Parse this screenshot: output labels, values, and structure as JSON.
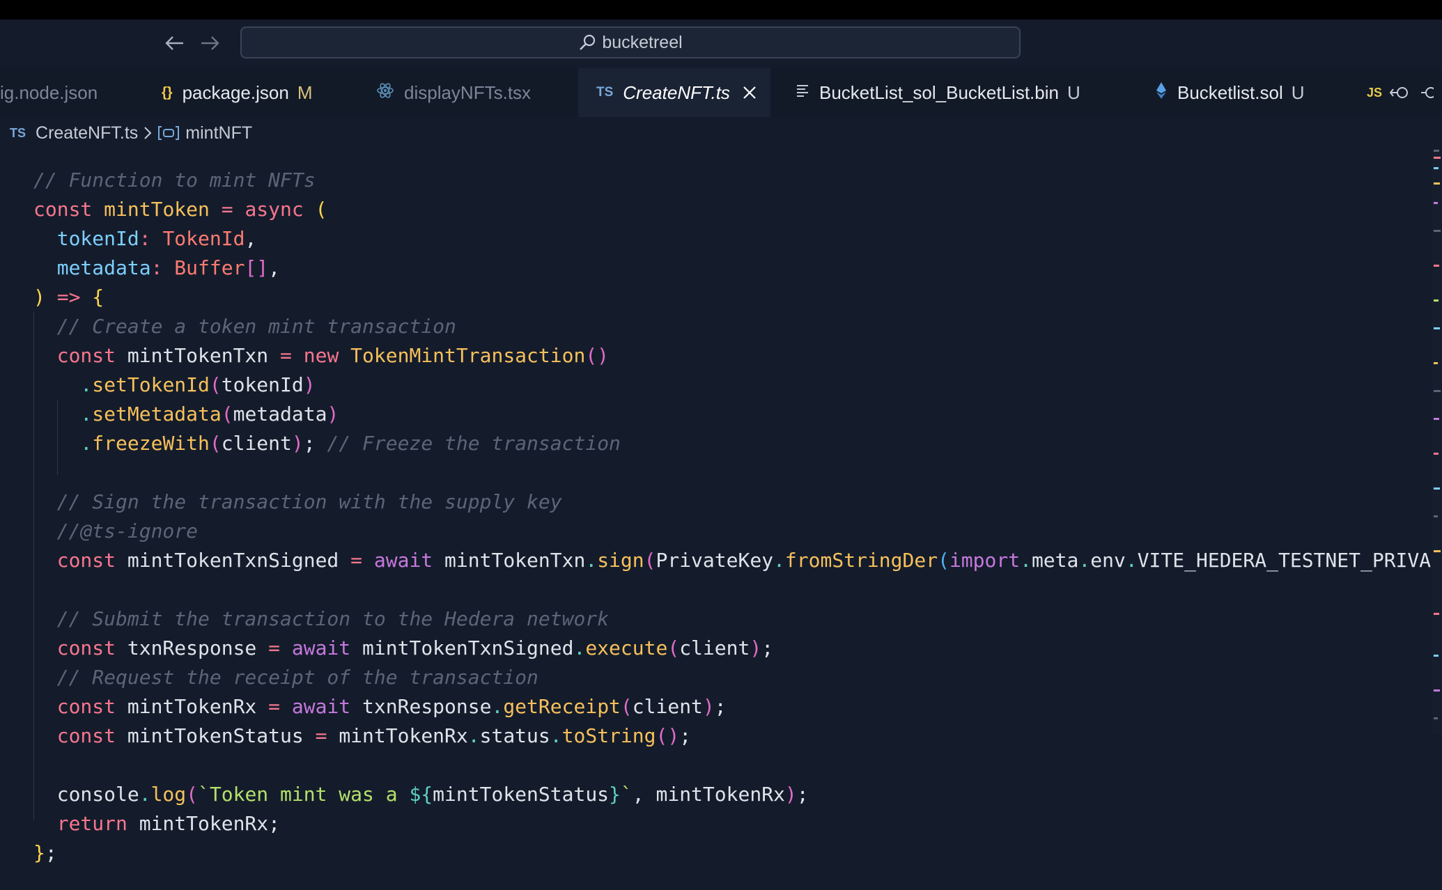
{
  "search": {
    "text": "bucketreel"
  },
  "tabs": [
    {
      "label": "ig.node.json",
      "icon": "",
      "mark": "",
      "state": "inactive"
    },
    {
      "label": "package.json",
      "icon": "{}",
      "mark": "M",
      "state": "normal"
    },
    {
      "label": "displayNFTs.tsx",
      "icon": "react-icon",
      "mark": "",
      "state": "inactive"
    },
    {
      "label": "CreateNFT.ts",
      "icon": "TS",
      "mark": "",
      "state": "active"
    },
    {
      "label": "BucketList_sol_BucketList.bin",
      "icon": "file-lines-icon",
      "mark": "U",
      "state": "normal"
    },
    {
      "label": "Bucketlist.sol",
      "icon": "ethereum-icon",
      "mark": "U",
      "state": "normal"
    },
    {
      "label": "",
      "icon": "JS",
      "mark": "",
      "state": "normal"
    }
  ],
  "breadcrumb": {
    "file_icon": "TS",
    "file": "CreateNFT.ts",
    "symbol": "mintNFT"
  },
  "code_lines": [
    [
      [
        "// Function to mint NFTs",
        "cmt"
      ]
    ],
    [
      [
        "const ",
        "kw"
      ],
      [
        "mintToken",
        "fn"
      ],
      [
        " = ",
        "op"
      ],
      [
        "async ",
        "kw"
      ],
      [
        "(",
        "br1"
      ]
    ],
    [
      [
        "  tokenId",
        "prm"
      ],
      [
        ": ",
        "op"
      ],
      [
        "TokenId",
        "ty"
      ],
      [
        ",",
        "pn"
      ]
    ],
    [
      [
        "  metadata",
        "prm"
      ],
      [
        ": ",
        "op"
      ],
      [
        "Buffer",
        "ty"
      ],
      [
        "[]",
        "br2"
      ],
      [
        ",",
        "pn"
      ]
    ],
    [
      [
        ")",
        "br1"
      ],
      [
        " => ",
        "op"
      ],
      [
        "{",
        "br1"
      ]
    ],
    [
      [
        "  // Create a token mint transaction",
        "cmt"
      ]
    ],
    [
      [
        "  const ",
        "kw"
      ],
      [
        "mintTokenTxn",
        "id"
      ],
      [
        " = ",
        "op"
      ],
      [
        "new ",
        "kw"
      ],
      [
        "TokenMintTransaction",
        "fn"
      ],
      [
        "()",
        "br2"
      ]
    ],
    [
      [
        "    .",
        "dot"
      ],
      [
        "setTokenId",
        "fn"
      ],
      [
        "(",
        "br2"
      ],
      [
        "tokenId",
        "id"
      ],
      [
        ")",
        "br2"
      ]
    ],
    [
      [
        "    .",
        "dot"
      ],
      [
        "setMetadata",
        "fn"
      ],
      [
        "(",
        "br2"
      ],
      [
        "metadata",
        "id"
      ],
      [
        ")",
        "br2"
      ]
    ],
    [
      [
        "    .",
        "dot"
      ],
      [
        "freezeWith",
        "fn"
      ],
      [
        "(",
        "br2"
      ],
      [
        "client",
        "id"
      ],
      [
        ")",
        "br2"
      ],
      [
        "; ",
        "pn"
      ],
      [
        "// Freeze the transaction",
        "cmt"
      ]
    ],
    [
      [
        "",
        "id"
      ]
    ],
    [
      [
        "  // Sign the transaction with the supply key",
        "cmt"
      ]
    ],
    [
      [
        "  //@ts-ignore",
        "cmt"
      ]
    ],
    [
      [
        "  const ",
        "kw"
      ],
      [
        "mintTokenTxnSigned",
        "id"
      ],
      [
        " = ",
        "op"
      ],
      [
        "await ",
        "kw2"
      ],
      [
        "mintTokenTxn",
        "id"
      ],
      [
        ".",
        "dot"
      ],
      [
        "sign",
        "fn"
      ],
      [
        "(",
        "br2"
      ],
      [
        "PrivateKey",
        "id"
      ],
      [
        ".",
        "dot"
      ],
      [
        "fromStringDer",
        "fn"
      ],
      [
        "(",
        "br3"
      ],
      [
        "import",
        "kw2"
      ],
      [
        ".",
        "dot"
      ],
      [
        "meta",
        "id"
      ],
      [
        ".",
        "dot"
      ],
      [
        "env",
        "id"
      ],
      [
        ".",
        "dot"
      ],
      [
        "VITE_HEDERA_TESTNET_PRIVA",
        "id"
      ]
    ],
    [
      [
        "",
        "id"
      ]
    ],
    [
      [
        "  // Submit the transaction to the Hedera network",
        "cmt"
      ]
    ],
    [
      [
        "  const ",
        "kw"
      ],
      [
        "txnResponse",
        "id"
      ],
      [
        " = ",
        "op"
      ],
      [
        "await ",
        "kw2"
      ],
      [
        "mintTokenTxnSigned",
        "id"
      ],
      [
        ".",
        "dot"
      ],
      [
        "execute",
        "fn"
      ],
      [
        "(",
        "br2"
      ],
      [
        "client",
        "id"
      ],
      [
        ")",
        "br2"
      ],
      [
        ";",
        "pn"
      ]
    ],
    [
      [
        "  // Request the receipt of the transaction",
        "cmt"
      ]
    ],
    [
      [
        "  const ",
        "kw"
      ],
      [
        "mintTokenRx",
        "id"
      ],
      [
        " = ",
        "op"
      ],
      [
        "await ",
        "kw2"
      ],
      [
        "txnResponse",
        "id"
      ],
      [
        ".",
        "dot"
      ],
      [
        "getReceipt",
        "fn"
      ],
      [
        "(",
        "br2"
      ],
      [
        "client",
        "id"
      ],
      [
        ")",
        "br2"
      ],
      [
        ";",
        "pn"
      ]
    ],
    [
      [
        "  const ",
        "kw"
      ],
      [
        "mintTokenStatus",
        "id"
      ],
      [
        " = ",
        "op"
      ],
      [
        "mintTokenRx",
        "id"
      ],
      [
        ".",
        "dot"
      ],
      [
        "status",
        "id"
      ],
      [
        ".",
        "dot"
      ],
      [
        "toString",
        "fn"
      ],
      [
        "()",
        "br2"
      ],
      [
        ";",
        "pn"
      ]
    ],
    [
      [
        "",
        "id"
      ]
    ],
    [
      [
        "  console",
        "id"
      ],
      [
        ".",
        "dot"
      ],
      [
        "log",
        "fn"
      ],
      [
        "(",
        "br2"
      ],
      [
        "`Token mint was a ",
        "str"
      ],
      [
        "${",
        "tpl"
      ],
      [
        "mintTokenStatus",
        "id"
      ],
      [
        "}",
        "tpl"
      ],
      [
        "`",
        "str"
      ],
      [
        ", ",
        "pn"
      ],
      [
        "mintTokenRx",
        "id"
      ],
      [
        ")",
        "br2"
      ],
      [
        ";",
        "pn"
      ]
    ],
    [
      [
        "  return ",
        "kw"
      ],
      [
        "mintTokenRx",
        "id"
      ],
      [
        ";",
        "pn"
      ]
    ],
    [
      [
        "}",
        "br1"
      ],
      [
        ";",
        "pn"
      ]
    ]
  ],
  "colors": {
    "background": "#141c2b",
    "comment": "#5c6577",
    "keyword": "#f7768e",
    "function": "#f7c05b",
    "string": "#b4e06a"
  }
}
